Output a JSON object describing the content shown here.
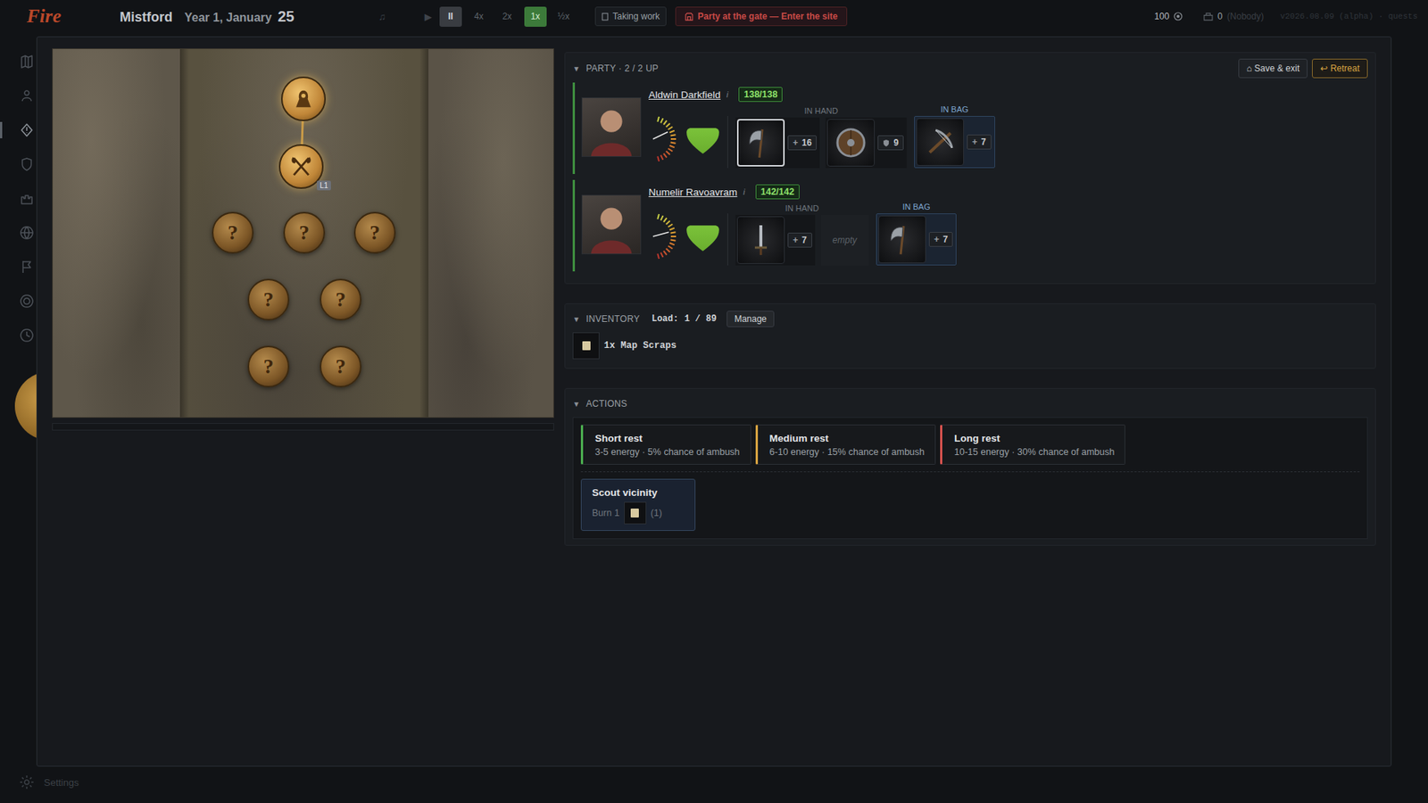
{
  "topbar": {
    "logo": "Fire",
    "town": "Mistford",
    "date": "Year 1, January",
    "day": "25",
    "media": [
      {
        "glyph": "♫"
      },
      {
        "glyph": "▶"
      }
    ],
    "pause": {
      "glyph": "II",
      "active": true
    },
    "speeds": [
      {
        "label": "4x",
        "selected": false
      },
      {
        "label": "2x",
        "selected": false
      },
      {
        "label": "1x",
        "selected": true
      },
      {
        "label": "½x",
        "selected": false
      }
    ],
    "status": "Taking work",
    "alert": "Party at the gate — Enter the site",
    "gold": "100",
    "followers": "0",
    "follower_name": "(Nobody)",
    "version": "v2026.08.09 (alpha) · quests"
  },
  "sidebar": {
    "items": [
      {
        "kind": "map",
        "selected": false
      },
      {
        "kind": "person",
        "selected": false
      },
      {
        "kind": "quest",
        "selected": true
      },
      {
        "kind": "shield",
        "selected": false
      },
      {
        "kind": "castle",
        "selected": false
      },
      {
        "kind": "globe",
        "selected": false
      },
      {
        "kind": "flag",
        "selected": false
      },
      {
        "kind": "web",
        "selected": false
      },
      {
        "kind": "clock",
        "selected": false
      }
    ],
    "settings": "Settings"
  },
  "map": {
    "nodes": [
      {
        "kind": "start",
        "label": "",
        "badge": "",
        "revealed": true
      },
      {
        "kind": "combat",
        "label": "",
        "badge": "L1",
        "revealed": true
      },
      {
        "kind": "unknown",
        "label": "?",
        "badge": "",
        "revealed": false
      },
      {
        "kind": "unknown",
        "label": "?",
        "badge": "",
        "revealed": false
      },
      {
        "kind": "unknown",
        "label": "?",
        "badge": "",
        "revealed": false
      },
      {
        "kind": "unknown",
        "label": "?",
        "badge": "",
        "revealed": false
      },
      {
        "kind": "unknown",
        "label": "?",
        "badge": "",
        "revealed": false
      },
      {
        "kind": "unknown",
        "label": "?",
        "badge": "",
        "revealed": false
      },
      {
        "kind": "unknown",
        "label": "?",
        "badge": "",
        "revealed": false
      }
    ],
    "edges": [
      [
        0,
        1
      ]
    ],
    "progress": {
      "level": 0
    }
  },
  "party": {
    "toggle": "▼",
    "title": "PARTY · 2 / 2 UP",
    "save": {
      "glyph": "⌂",
      "label": "Save & exit"
    },
    "retreat": {
      "glyph": "↩",
      "label": "Retreat"
    },
    "members": [
      {
        "name": "Aldwin Darkfield",
        "info": "i",
        "hp": "138/138",
        "energy": 0.67,
        "morale": 1,
        "hand_label": "IN HAND",
        "bag_label": "IN BAG",
        "hand": [
          {
            "kind": "axe",
            "badge_kind": "attack",
            "badge_glyph": "+",
            "value": "16",
            "selected": true,
            "label": ""
          },
          {
            "kind": "shield",
            "badge_kind": "defense",
            "badge_glyph": "",
            "value": "9",
            "selected": false,
            "label": ""
          }
        ],
        "bag": [
          {
            "kind": "crossbow",
            "badge_kind": "attack",
            "badge_glyph": "+",
            "value": "7",
            "selected": false,
            "label": ""
          }
        ]
      },
      {
        "name": "Numelir Ravoavram",
        "info": "i",
        "hp": "142/142",
        "energy": 0.6,
        "morale": 1,
        "hand_label": "IN HAND",
        "bag_label": "IN BAG",
        "hand": [
          {
            "kind": "sword",
            "badge_kind": "attack",
            "badge_glyph": "+",
            "value": "7",
            "selected": false,
            "label": ""
          },
          {
            "kind": "empty",
            "badge_kind": "",
            "badge_glyph": "",
            "value": "",
            "selected": false,
            "label": "empty"
          }
        ],
        "bag": [
          {
            "kind": "axe",
            "badge_kind": "attack",
            "badge_glyph": "+",
            "value": "7",
            "selected": false,
            "label": ""
          }
        ]
      }
    ]
  },
  "inventory": {
    "toggle": "▼",
    "title": "INVENTORY",
    "load_label": "Load:",
    "load": "1 / 89",
    "manage": "Manage",
    "items": [
      {
        "kind": "scroll",
        "label": "1x Map Scraps"
      }
    ]
  },
  "actions": {
    "toggle": "▼",
    "title": "ACTIONS",
    "rests": [
      {
        "name": "Short rest",
        "desc": "3-5 energy · 5% chance of ambush",
        "color": "#4caf50"
      },
      {
        "name": "Medium rest",
        "desc": "6-10 energy · 15% chance of ambush",
        "color": "#d9a441"
      },
      {
        "name": "Long rest",
        "desc": "10-15 energy · 30% chance of ambush",
        "color": "#d9534f"
      }
    ],
    "scout": {
      "title": "Scout vicinity",
      "burn": "Burn 1",
      "count": "(1)"
    }
  }
}
